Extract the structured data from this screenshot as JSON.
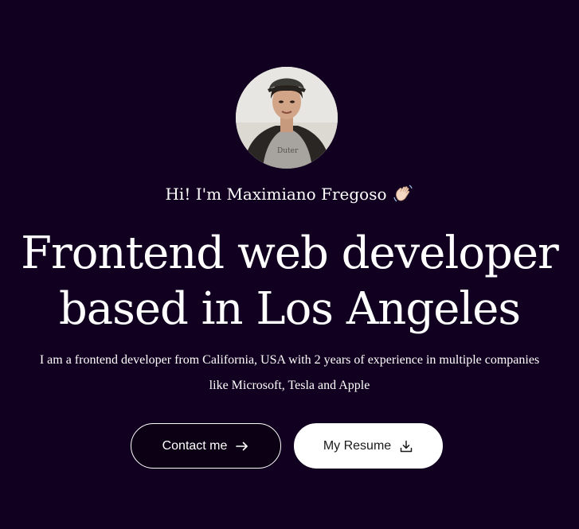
{
  "hero": {
    "avatar_icon": "profile-photo",
    "greeting": "Hi! I'm Maximiano Fregoso",
    "greeting_icon": "waving-hand-icon",
    "headline_line1": "Frontend web developer",
    "headline_line2": "based in Los Angeles",
    "intro": "I am a frontend developer from California, USA with 2 years of experience in multiple companies like Microsoft, Tesla and Apple"
  },
  "actions": {
    "contact_label": "Contact me",
    "contact_icon": "arrow-right-icon",
    "resume_label": "My Resume",
    "resume_icon": "download-icon"
  },
  "colors": {
    "background": "#11001f",
    "text": "#ffffff",
    "resume_button_bg": "#ffffff"
  }
}
